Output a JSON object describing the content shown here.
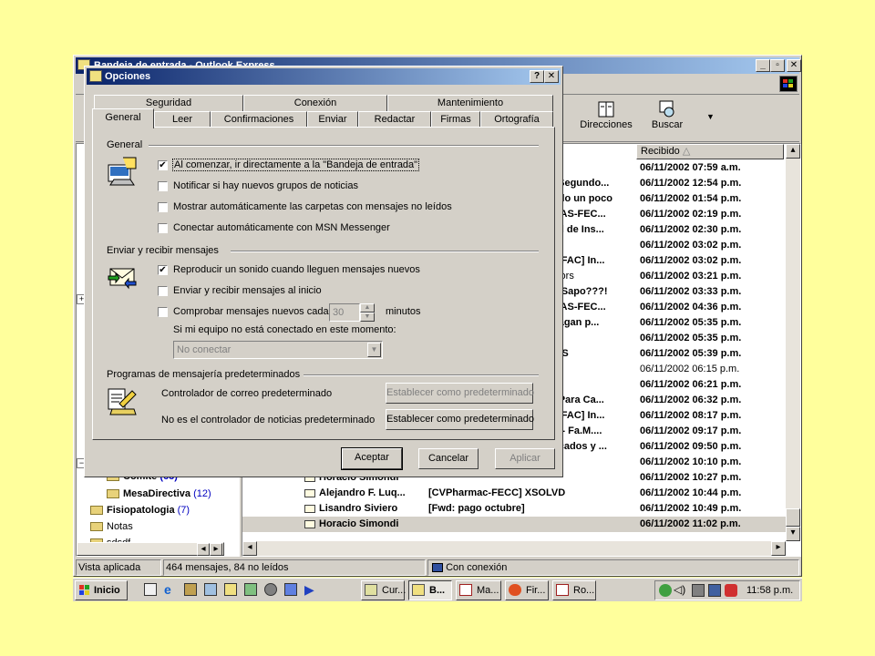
{
  "main_window": {
    "title": "Bandeja de entrada - Outlook Express",
    "toolbar": {
      "directions": "Direcciones",
      "search": "Buscar"
    },
    "list_header": {
      "received": "Recibido"
    },
    "messages": [
      {
        "from": "",
        "subject": "",
        "received": "06/11/2002 07:59 a.m."
      },
      {
        "from": "",
        "subject": "l Segundo...",
        "received": "06/11/2002 12:54 p.m."
      },
      {
        "from": "",
        "subject": "odo un poco",
        "received": "06/11/2002 01:54 p.m."
      },
      {
        "from": "",
        "subject": "GAS-FEC...",
        "received": "06/11/2002 02:19 p.m."
      },
      {
        "from": "",
        "subject": "ad de Ins...",
        "received": "06/11/2002 02:30 p.m."
      },
      {
        "from": "",
        "subject": "",
        "received": "06/11/2002 03:02 p.m."
      },
      {
        "from": "",
        "subject": "s-FAC] In...",
        "received": "06/11/2002 03:02 p.m."
      },
      {
        "from": "",
        "subject": "ctors",
        "received": "06/11/2002 03:21 p.m."
      },
      {
        "from": "",
        "subject": "o Sapo???!",
        "received": "06/11/2002 03:33 p.m."
      },
      {
        "from": "",
        "subject": "GAS-FEC...",
        "received": "06/11/2002 04:36 p.m."
      },
      {
        "from": "",
        "subject": "pagan p...",
        "received": "06/11/2002 05:35 p.m."
      },
      {
        "from": "",
        "subject": "",
        "received": "06/11/2002 05:35 p.m."
      },
      {
        "from": "",
        "subject": "E S",
        "received": "06/11/2002 05:39 p.m."
      },
      {
        "from": "",
        "subject": "",
        "received": "06/11/2002 06:15 p.m."
      },
      {
        "from": "",
        "subject": "",
        "received": "06/11/2002 06:21 p.m."
      },
      {
        "from": "",
        "subject": "] Para Ca...",
        "received": "06/11/2002 06:32 p.m."
      },
      {
        "from": "",
        "subject": "s-FAC] In...",
        "received": "06/11/2002 08:17 p.m."
      },
      {
        "from": "",
        "subject": "X - Fa.M....",
        "received": "06/11/2002 09:17 p.m."
      },
      {
        "from": "",
        "subject": "ficados y ...",
        "received": "06/11/2002 09:50 p.m."
      },
      {
        "from": "",
        "subject": "",
        "received": "06/11/2002 10:10 p.m."
      },
      {
        "from": "Horacio Simondi",
        "subject": "",
        "received": "06/11/2002 10:27 p.m."
      },
      {
        "from": "Alejandro F. Luq...",
        "subject": "[CVPharmac-FECC] XSOLVD",
        "received": "06/11/2002 10:44 p.m."
      },
      {
        "from": "Lisandro Siviero",
        "subject": "[Fwd: pago octubre]",
        "received": "06/11/2002 10:49 p.m."
      },
      {
        "from": "Horacio Simondi",
        "subject": "",
        "received": "06/11/2002 11:02 p.m."
      }
    ],
    "folders": [
      {
        "name": "Comite",
        "count": "(63)"
      },
      {
        "name": "MesaDirectiva",
        "count": "(12)"
      },
      {
        "name": "Fisiopatologia",
        "count": "(7)"
      },
      {
        "name": "Notas",
        "count": ""
      },
      {
        "name": "sdsdf",
        "count": ""
      }
    ],
    "status": {
      "view": "Vista aplicada",
      "counts": "464 mensajes, 84 no leídos",
      "connection": "Con conexión"
    }
  },
  "dialog": {
    "title": "Opciones",
    "tabs_back": [
      "Seguridad",
      "Conexión",
      "Mantenimiento"
    ],
    "tabs_front": [
      "General",
      "Leer",
      "Confirmaciones",
      "Enviar",
      "Redactar",
      "Firmas",
      "Ortografía"
    ],
    "sections": {
      "general": "General",
      "send_receive": "Enviar y recibir mensajes",
      "programs": "Programas de mensajería predeterminados"
    },
    "general_options": [
      {
        "label": "Al comenzar, ir directamente a la \"Bandeja de entrada\"",
        "checked": "✔"
      },
      {
        "label": "Notificar si hay nuevos grupos de noticias",
        "checked": ""
      },
      {
        "label": "Mostrar automáticamente las carpetas con mensajes no leídos",
        "checked": ""
      },
      {
        "label": "Conectar automáticamente con MSN Messenger",
        "checked": ""
      }
    ],
    "send_options": [
      {
        "label": "Reproducir un sonido cuando lleguen mensajes nuevos",
        "checked": "✔"
      },
      {
        "label": "Enviar y recibir mensajes al inicio",
        "checked": ""
      },
      {
        "label": "Comprobar mensajes nuevos cada",
        "checked": ""
      }
    ],
    "check_interval": "30",
    "minutes_label": "minutos",
    "offline_label": "Si mi equipo no está conectado en este momento:",
    "offline_select": "No conectar",
    "mail_default_label": "Controlador de correo predeterminado",
    "news_default_label": "No es el controlador de noticias predeterminado",
    "set_default_button": "Establecer como predeterminado",
    "buttons": {
      "ok": "Aceptar",
      "cancel": "Cancelar",
      "apply": "Aplicar"
    }
  },
  "taskbar": {
    "start": "Inicio",
    "tasks": [
      "Cur...",
      "B...",
      "Ma...",
      "Fir...",
      "Ro..."
    ],
    "clock": "11:58 p.m."
  }
}
